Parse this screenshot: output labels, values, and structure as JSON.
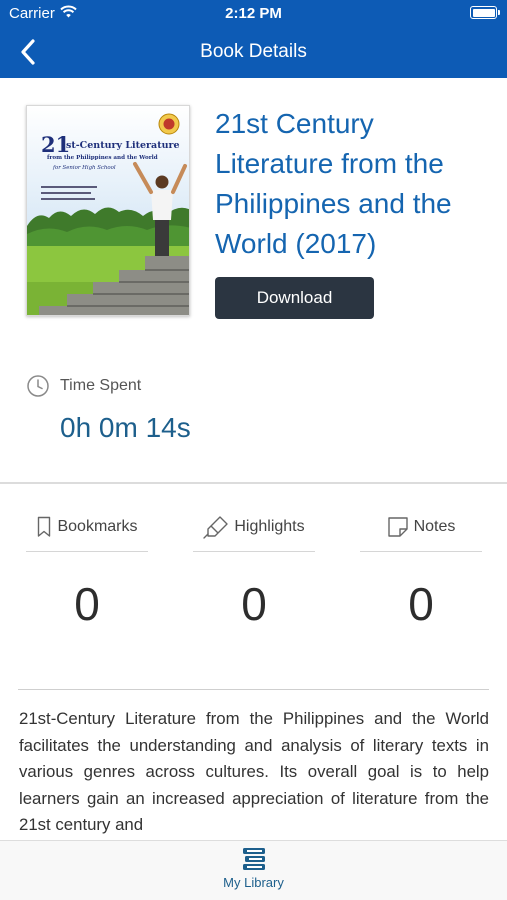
{
  "status_bar": {
    "carrier": "Carrier",
    "time": "2:12 PM"
  },
  "nav": {
    "title": "Book Details"
  },
  "book": {
    "title": "21st Century Literature from the Philippines and the World (2017)",
    "download_label": "Download",
    "cover": {
      "title_line": "st-Century Literature",
      "title_number": "21",
      "subtitle": "from the Philippines and the World",
      "audience": "for Senior High School"
    }
  },
  "time_spent": {
    "label": "Time Spent",
    "value": "0h 0m 14s"
  },
  "stats": [
    {
      "label": "Bookmarks",
      "count": "0",
      "icon": "bookmark-icon"
    },
    {
      "label": "Highlights",
      "count": "0",
      "icon": "highlighter-icon"
    },
    {
      "label": "Notes",
      "count": "0",
      "icon": "note-icon"
    }
  ],
  "description": "21st-Century Literature from the Philippines and the World facilitates the understanding and analysis of literary texts in various genres across cultures. Its overall goal is to help learners gain an increased appreciation of literature from the 21st century and",
  "tab_bar": {
    "items": [
      {
        "label": "My Library",
        "icon": "books-icon"
      }
    ]
  },
  "colors": {
    "header": "#0d5bb5",
    "accent": "#1565b0",
    "button": "#2b3541",
    "time_value": "#1d5f8c"
  }
}
